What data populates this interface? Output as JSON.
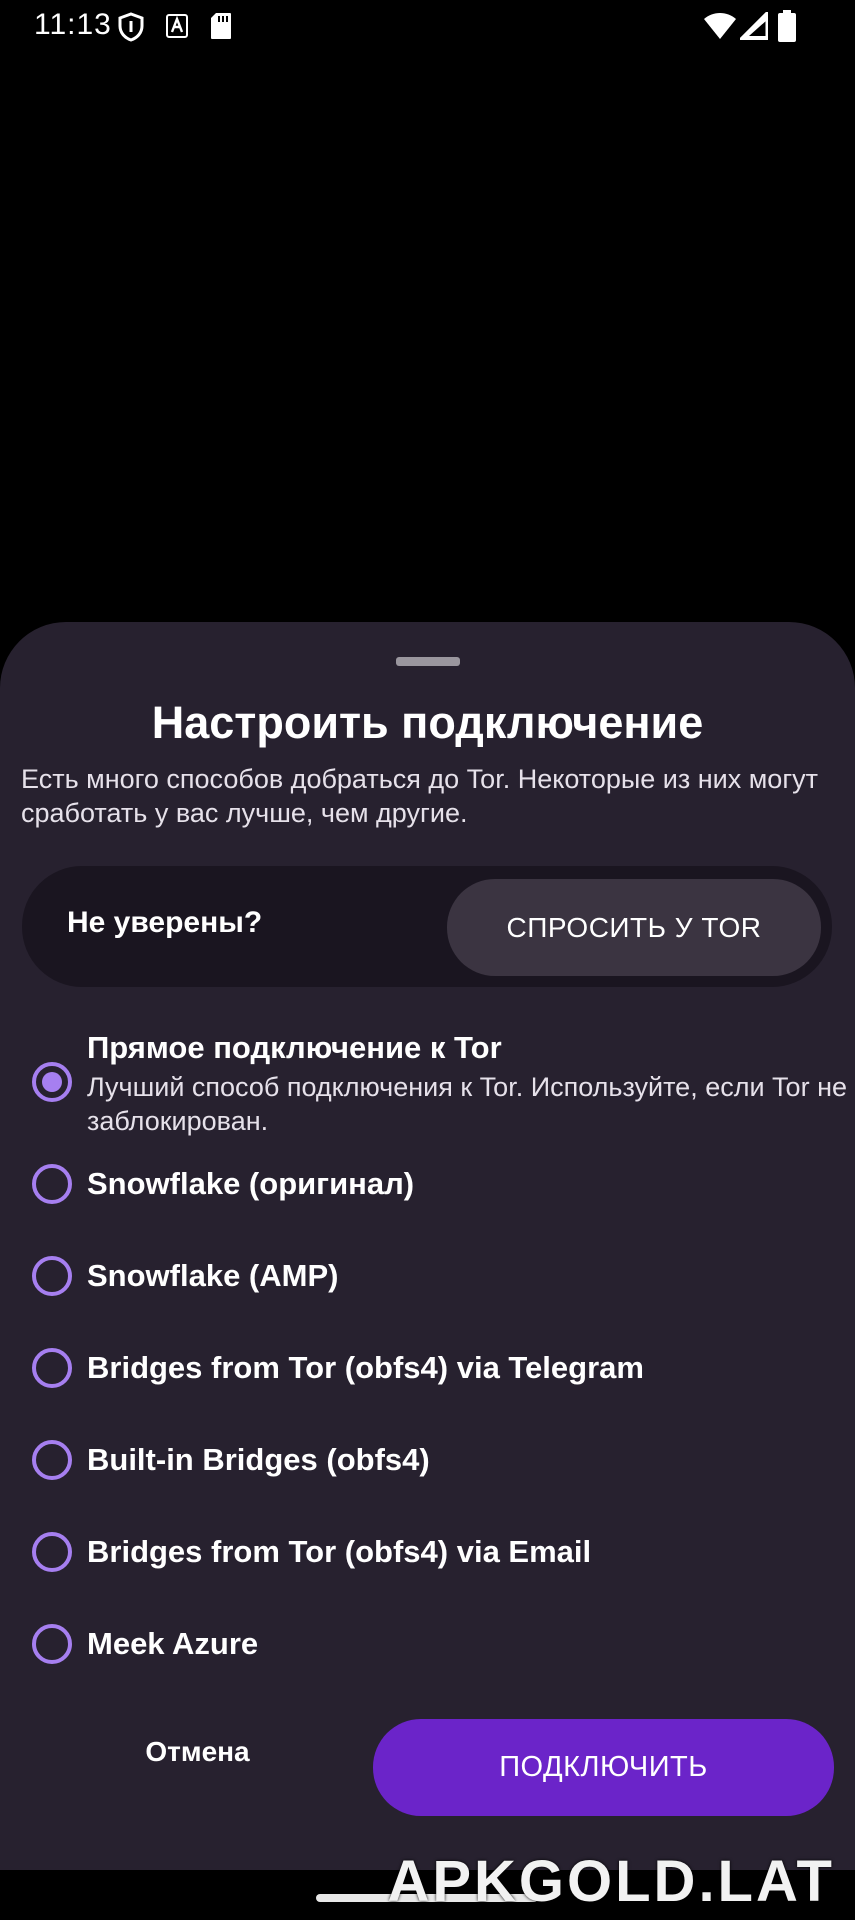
{
  "status_bar": {
    "time": "11:13"
  },
  "sheet": {
    "title": "Настроить подключение",
    "description": "Есть много способов добраться до Tor. Некоторые из них могут сработать у вас лучше, чем другие.",
    "unsure": {
      "label": "Не уверены?",
      "button": "СПРОСИТЬ У TOR"
    },
    "options": [
      {
        "title": "Прямое подключение к Tor",
        "description": "Лучший способ подключения к Tor. Используйте, если Tor не заблокирован.",
        "selected": true
      },
      {
        "title": "Snowflake (оригинал)",
        "selected": false
      },
      {
        "title": "Snowflake (AMP)",
        "selected": false
      },
      {
        "title": "Bridges from Tor (obfs4) via Telegram",
        "selected": false
      },
      {
        "title": "Built-in Bridges (obfs4)",
        "selected": false
      },
      {
        "title": "Bridges from Tor (obfs4) via Email",
        "selected": false
      },
      {
        "title": "Meek Azure",
        "selected": false
      }
    ],
    "cancel_label": "Отмена",
    "connect_label": "ПОДКЛЮЧИТЬ"
  },
  "watermark": "APKGOLD.LAT",
  "colors": {
    "sheet_background": "#27212f",
    "accent": "#a67ff0",
    "primary_button": "#6b24c9"
  },
  "icons": [
    "vpn-shield-icon",
    "font-icon",
    "sd-card-icon",
    "wifi-icon",
    "cellular-signal-icon",
    "battery-icon"
  ]
}
